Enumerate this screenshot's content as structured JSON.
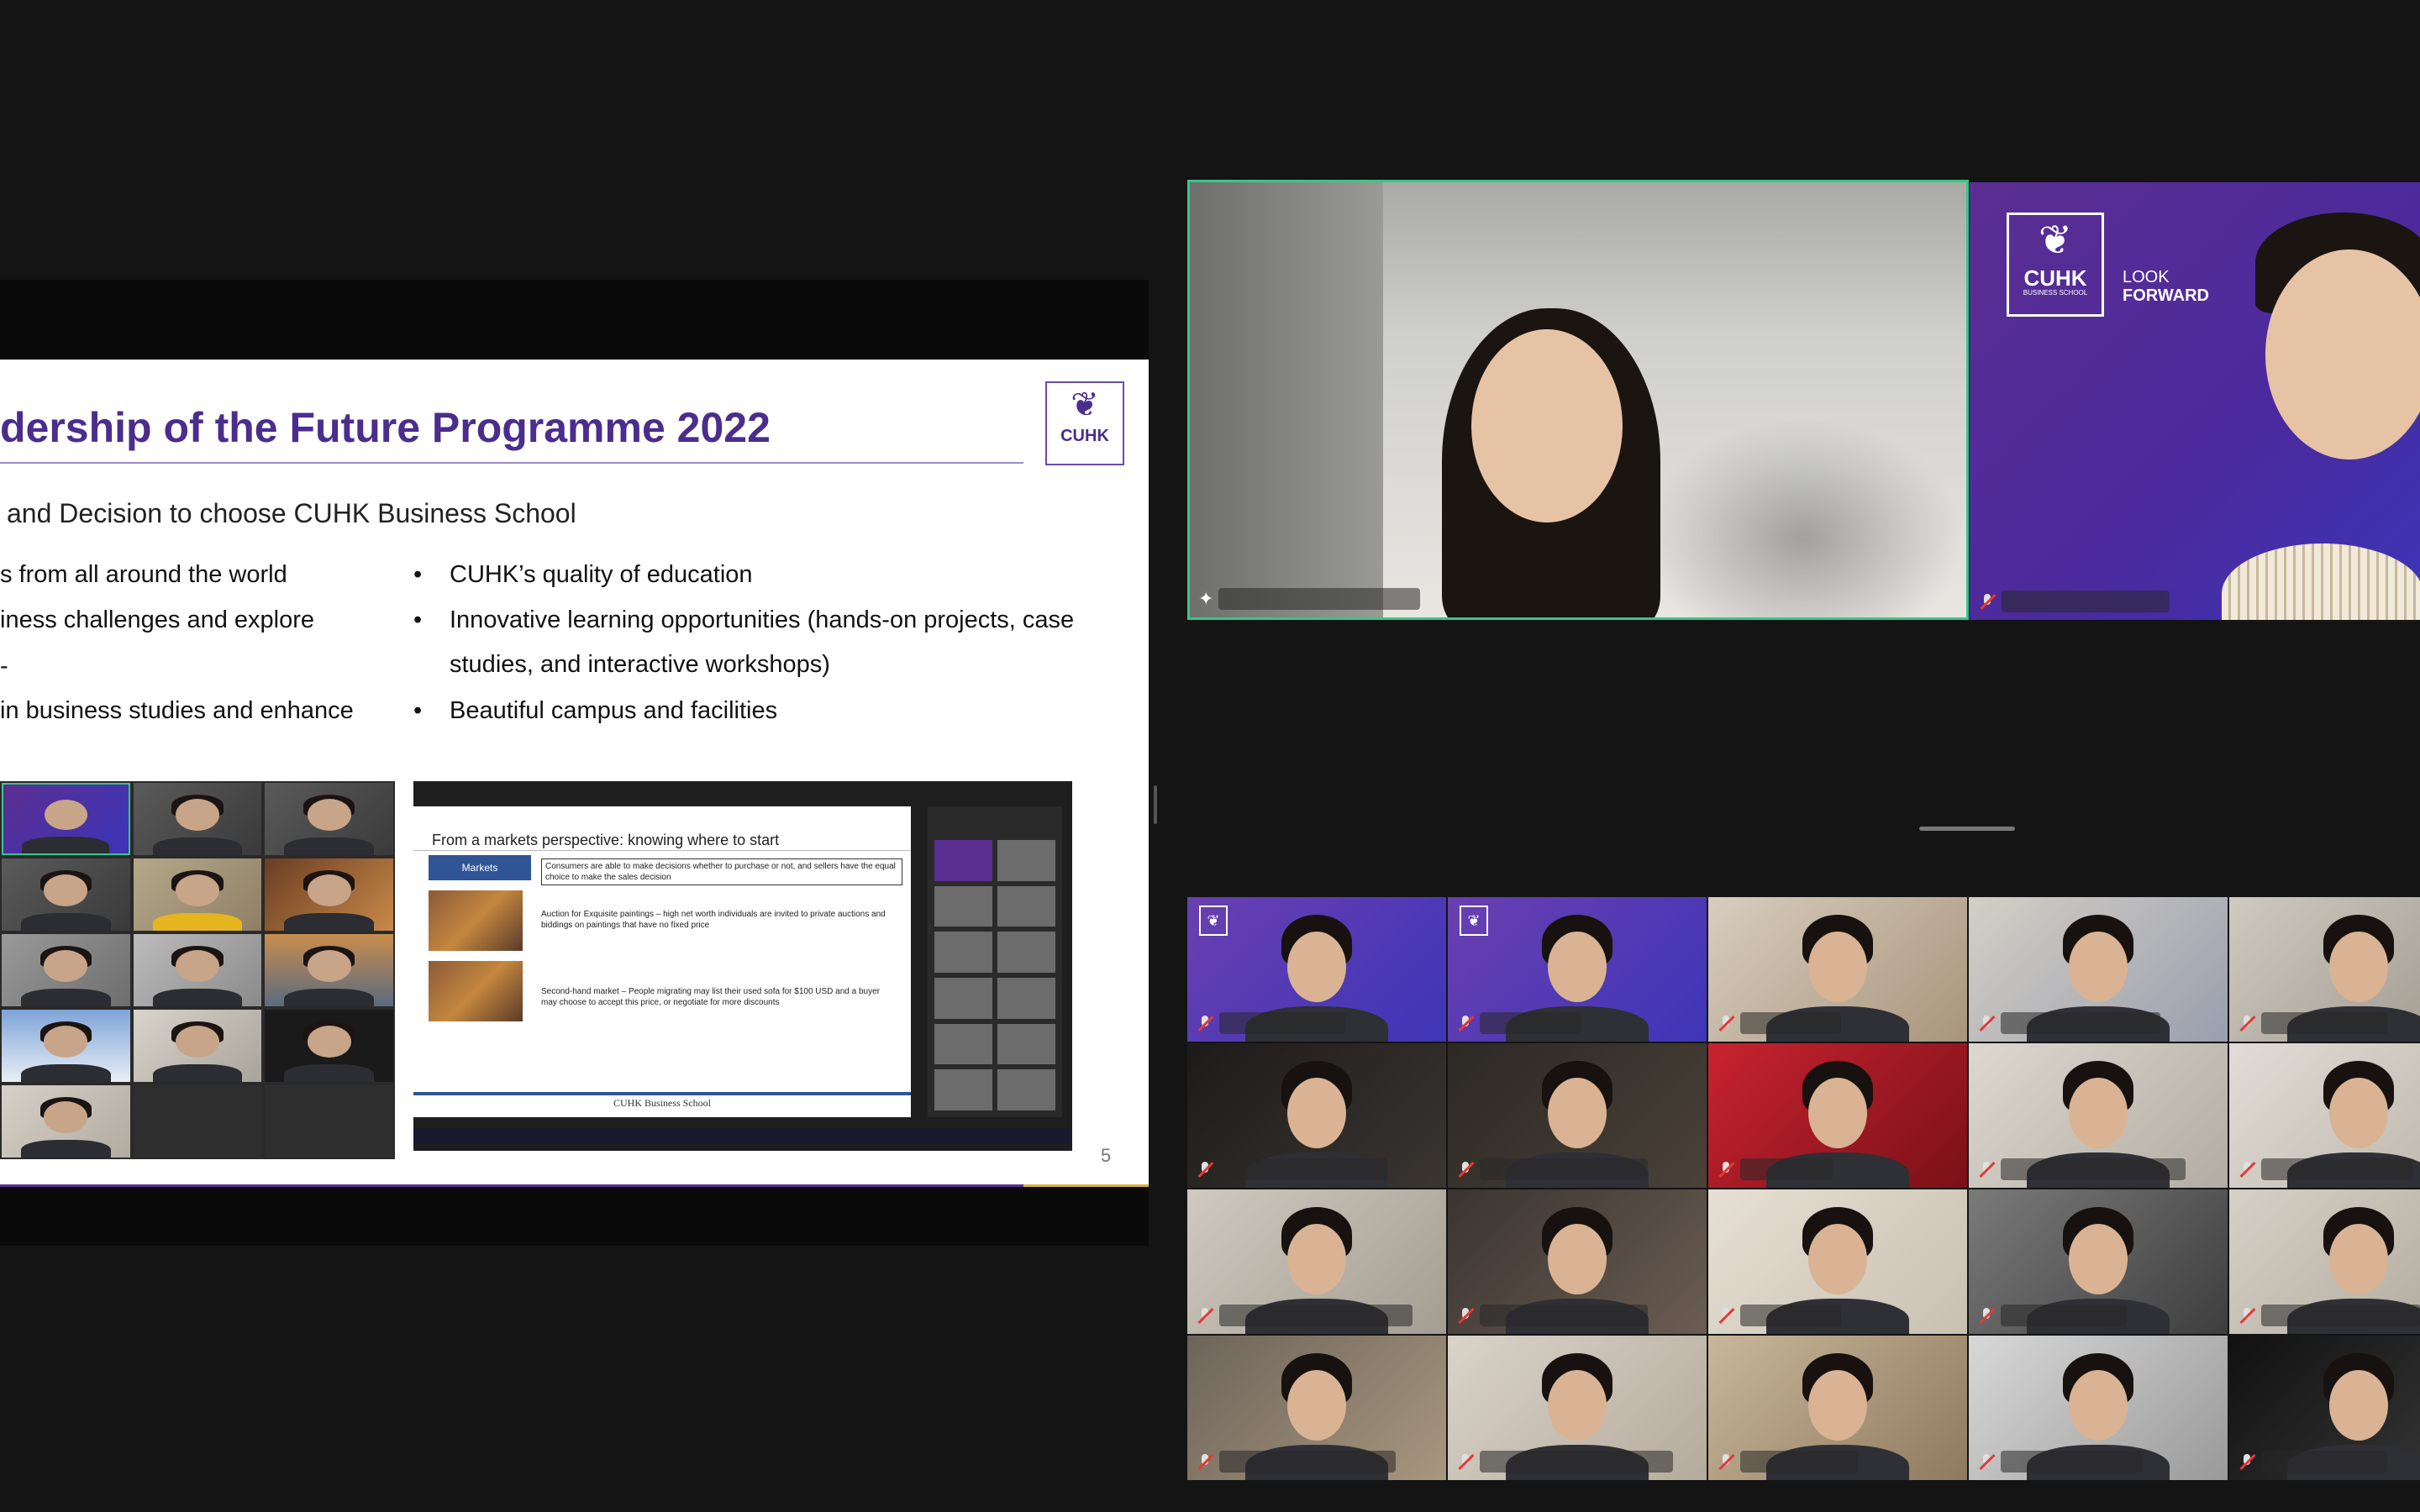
{
  "slide": {
    "title": "dership of the Future Programme 2022",
    "logo_text": "CUHK",
    "subtitle": "and Decision to choose CUHK Business School",
    "left_lines": [
      "s from all around the world",
      "iness challenges and explore",
      "in business studies and enhance"
    ],
    "right_bullets": [
      "CUHK’s quality of education",
      "Innovative learning opportunities (hands-on projects, case",
      "studies, and interactive workshops)",
      "Beautiful campus and facilities"
    ],
    "bullet_char": "•",
    "page_number": "5",
    "accent_color": "#4a2d8c",
    "nested_slide": {
      "title": "From a markets perspective: knowing where to start",
      "markets_label": "Markets",
      "consumers_text": "Consumers are able to make decisions whether to purchase or not, and sellers have the equal choice to make the sales decision",
      "auction_text": "Auction for Exquisite paintings – high net worth individuals are invited to private auctions and biddings on paintings that have no fixed price",
      "secondhand_text": "Second-hand market – People migrating may list their used sofa for $100 USD and a buyer may choose to accept this price, or negotiate for more discounts",
      "footer": "CUHK Business School"
    }
  },
  "speakers": {
    "speaker2_logo_text": "CUHK",
    "speaker2_logo_sub": "BUSINESS SCHOOL",
    "speaker2_tagline_1": "LOOK",
    "speaker2_tagline_2": "FORWARD",
    "active_border_color": "#36c78d"
  },
  "gallery_count": 20,
  "muted_icon": "mic-muted-icon"
}
